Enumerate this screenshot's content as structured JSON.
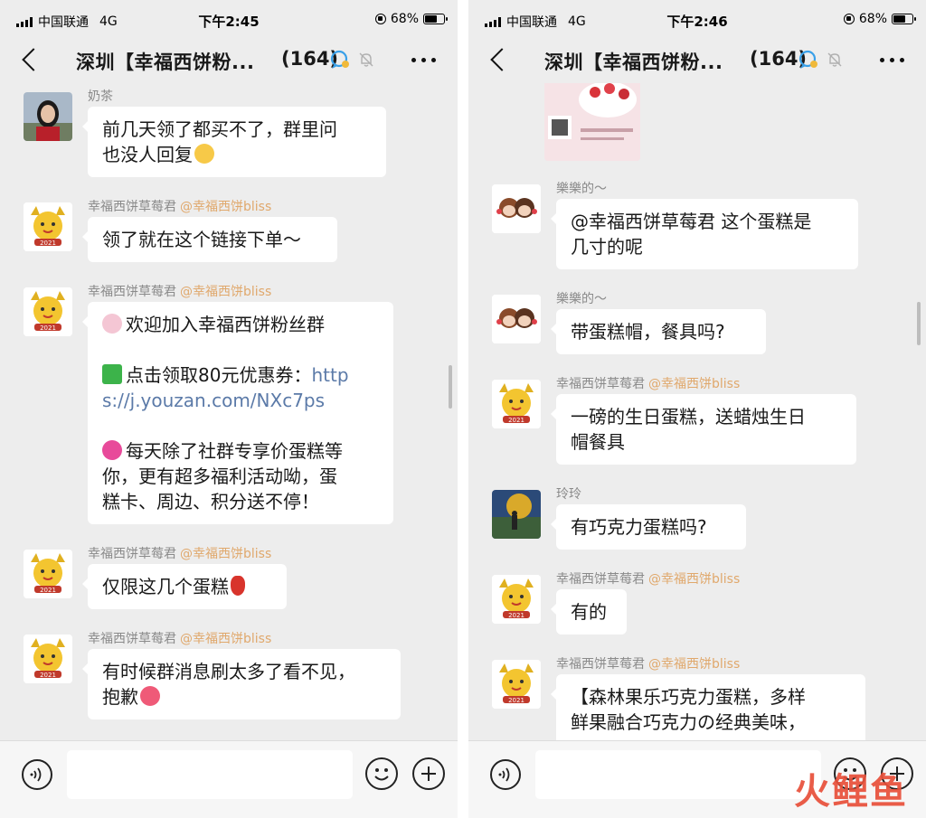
{
  "left": {
    "status": {
      "carrier": "中国联通",
      "network": "4G",
      "time": "下午2:45",
      "battery": "68%",
      "battery_level": 0.68
    },
    "nav": {
      "title": "深圳【幸福西饼粉...",
      "count": "(164)"
    },
    "messages": [
      {
        "sender": "奶茶",
        "lines": [
          "前几天领了都买不了，群里问",
          "也没人回复"
        ]
      },
      {
        "sender": "幸福西饼草莓君",
        "mention": "@幸福西饼bliss",
        "lines": [
          "领了就在这个链接下单～"
        ]
      },
      {
        "sender": "幸福西饼草莓君",
        "mention": "@幸福西饼bliss",
        "p1": "欢迎加入幸福西饼粉丝群",
        "p2_text": "点击领取80元优惠券：",
        "p2_link1": "http",
        "p2_link2": "s://j.youzan.com/NXc7ps",
        "p3": [
          "每天除了社群专享价蛋糕等",
          "你，更有超多福利活动呦，蛋",
          "糕卡、周边、积分送不停！"
        ]
      },
      {
        "sender": "幸福西饼草莓君",
        "mention": "@幸福西饼bliss",
        "lines": [
          "仅限这几个蛋糕"
        ]
      },
      {
        "sender": "幸福西饼草莓君",
        "mention": "@幸福西饼bliss",
        "lines": [
          "有时候群消息刷太多了看不见，",
          "抱歉"
        ]
      }
    ]
  },
  "right": {
    "status": {
      "carrier": "中国联通",
      "network": "4G",
      "time": "下午2:46",
      "battery": "68%",
      "battery_level": 0.68
    },
    "nav": {
      "title": "深圳【幸福西饼粉...",
      "count": "(164)"
    },
    "messages": [
      {
        "sender": "樂樂的～",
        "lines": [
          "@幸福西饼草莓君 这个蛋糕是",
          "几寸的呢"
        ]
      },
      {
        "sender": "樂樂的～",
        "lines": [
          "带蛋糕帽，餐具吗?"
        ]
      },
      {
        "sender": "幸福西饼草莓君",
        "mention": "@幸福西饼bliss",
        "lines": [
          "一磅的生日蛋糕，送蜡烛生日",
          "帽餐具"
        ]
      },
      {
        "sender": "玲玲",
        "lines": [
          "有巧克力蛋糕吗?"
        ]
      },
      {
        "sender": "幸福西饼草莓君",
        "mention": "@幸福西饼bliss",
        "lines": [
          "有的"
        ]
      },
      {
        "sender": "幸福西饼草莓君",
        "mention": "@幸福西饼bliss",
        "lines": [
          "【森林果乐巧克力蛋糕，多样",
          "鲜果融合巧克力の经典美味，"
        ]
      }
    ]
  },
  "watermark": "火鲤鱼",
  "colors": {
    "chat_bg": "#ededed",
    "bubble": "#ffffff",
    "mention": "#e0a86c",
    "link": "#5b7aa8"
  }
}
